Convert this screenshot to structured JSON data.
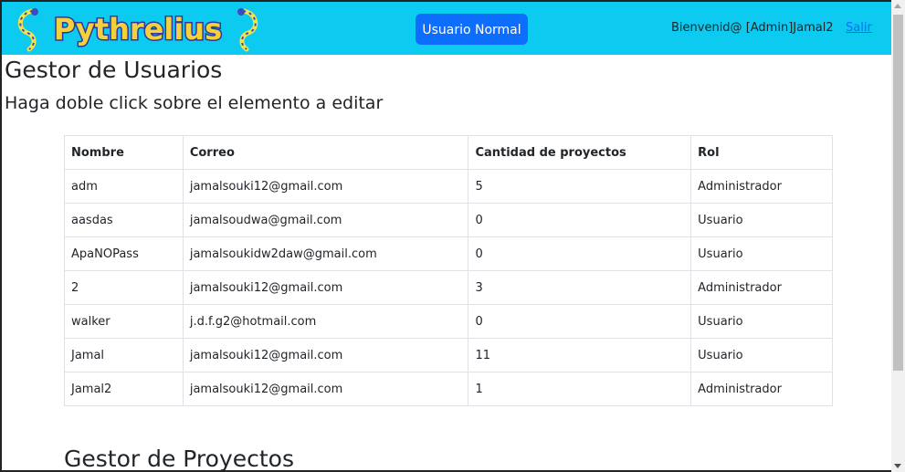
{
  "navbar": {
    "logo_text": "Pythrelius",
    "mode_button_label": "Usuario Normal",
    "welcome_text": "Bienvenid@ [Admin]Jamal2",
    "logout_label": "Salir"
  },
  "page": {
    "title": "Gestor de Usuarios",
    "subtitle": "Haga doble click sobre el elemento a editar",
    "next_section_title": "Gestor de Proyectos"
  },
  "users_table": {
    "headers": [
      "Nombre",
      "Correo",
      "Cantidad de proyectos",
      "Rol"
    ],
    "rows": [
      [
        "adm",
        "jamalsouki12@gmail.com",
        "5",
        "Administrador"
      ],
      [
        "aasdas",
        "jamalsoudwa@gmail.com",
        "0",
        "Usuario"
      ],
      [
        "ApaNOPass",
        "jamalsoukidw2daw@gmail.com",
        "0",
        "Usuario"
      ],
      [
        "2",
        "jamalsouki12@gmail.com",
        "3",
        "Administrador"
      ],
      [
        "walker",
        "j.d.f.g2@hotmail.com",
        "0",
        "Usuario"
      ],
      [
        "Jamal",
        "jamalsouki12@gmail.com",
        "11",
        "Usuario"
      ],
      [
        "Jamal2",
        "jamalsouki12@gmail.com",
        "1",
        "Administrador"
      ]
    ]
  },
  "colors": {
    "navbar": "#0dcaf0",
    "primary_button": "#0d6efd",
    "link": "#0d6efd"
  }
}
